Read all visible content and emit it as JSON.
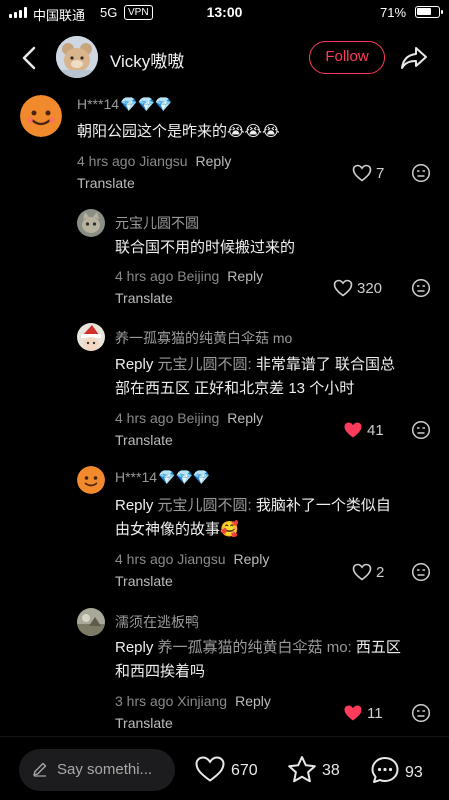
{
  "status_bar": {
    "carrier": "中国联通",
    "network": "5G",
    "vpn": "VPN",
    "time": "13:00",
    "battery_pct": "71%",
    "battery_level": 0.71
  },
  "header": {
    "title": "Vicky嗷嗷",
    "follow_label": "Follow"
  },
  "comments": [
    {
      "user": "H***14",
      "gems": "💎💎💎",
      "text": "朝阳公园这个是昨来的",
      "emoji": "😭😭😭",
      "meta": "4 hrs ago Jiangsu",
      "reply": "Reply",
      "translate": "Translate",
      "likes": "7"
    },
    {
      "user": "元宝儿圆不圆",
      "text": "联合国不用的时候搬过来的",
      "meta": "4 hrs ago Beijing",
      "reply": "Reply",
      "translate": "Translate",
      "likes": "320"
    },
    {
      "user": "养一孤寡猫的纯黄白伞菇 mo",
      "reply_prefix": "Reply",
      "reply_to": "元宝儿圆不圆:",
      "text_line1": " 非常靠谱了 联合国总",
      "text_line2": "部在西五区 正好和北京差 13 个小时",
      "meta": "4 hrs ago Beijing",
      "reply": "Reply",
      "translate": "Translate",
      "likes": "41",
      "liked": true
    },
    {
      "user": "H***14",
      "gems": "💎💎💎",
      "reply_prefix": "Reply",
      "reply_to": "元宝儿圆不圆:",
      "text_line1": " 我脑补了一个类似自",
      "text_line2": "由女神像的故事",
      "emoji": "🥰",
      "meta": "4 hrs ago Jiangsu",
      "reply": "Reply",
      "translate": "Translate",
      "likes": "2"
    },
    {
      "user": "濡须在逃板鸭",
      "reply_prefix": "Reply",
      "reply_to": "养一孤寡猫的纯黄白伞菇 mo:",
      "text_line1": " 西五区",
      "text_line2": "和西四挨着吗",
      "meta": "3 hrs ago Xinjiang",
      "reply": "Reply",
      "translate": "Translate",
      "likes": "11",
      "liked": true
    }
  ],
  "bottom_bar": {
    "input_placeholder": "Say somethi...",
    "likes": "670",
    "favorites": "38",
    "comments": "93"
  },
  "colors": {
    "accent": "#ff3b5c",
    "background": "#000000",
    "liked_heart": "#ff3b5c",
    "gem": "#4fc3f7"
  }
}
